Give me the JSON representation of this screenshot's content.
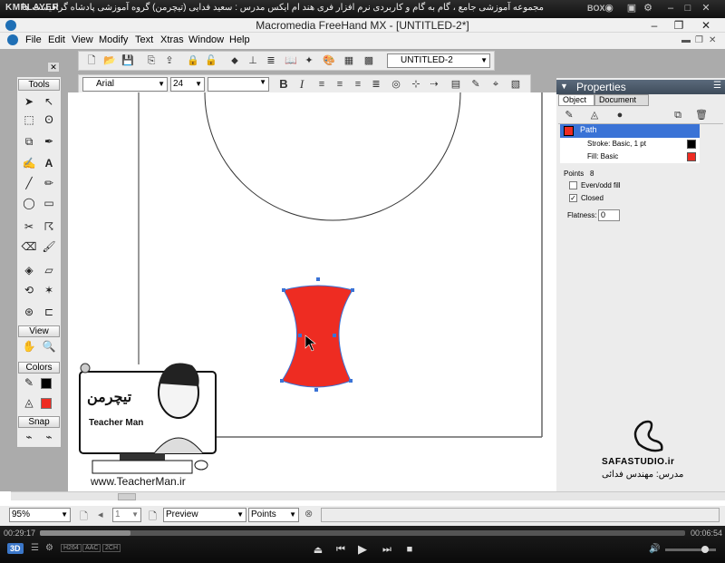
{
  "kmplayer": {
    "logo": "KMPLAYER",
    "title": "مجموعه آموزشی جامع ، گام به گام و کاربردی نرم افزار فری هند ام ایکس   مدرس : سعید فدایی (تیچرمن) گروه آموزشی پادشاه گرافیست ها",
    "box_label": "BOX",
    "time_current": "00:29:17",
    "time_total": "00:06:54",
    "badge_3d": "3D",
    "codec_labels": [
      "H264",
      "AAC",
      "2CH"
    ],
    "progress_fraction": 0.14
  },
  "app": {
    "title": "Macromedia FreeHand MX - [UNTITLED-2*]",
    "menu": [
      "File",
      "Edit",
      "View",
      "Modify",
      "Text",
      "Xtras",
      "Window",
      "Help"
    ],
    "document_name": "UNTITLED-2",
    "font_name": "Arial",
    "font_size": "24",
    "bold_label": "B",
    "italic_label": "I"
  },
  "tools": {
    "header": "Tools",
    "view_header": "View",
    "colors_header": "Colors",
    "snap_header": "Snap"
  },
  "properties": {
    "header": "Properties",
    "tabs": [
      "Object",
      "Document"
    ],
    "items": [
      {
        "label": "Path",
        "selected": true
      },
      {
        "label": "Stroke: Basic, 1 pt"
      },
      {
        "label": "Fill: Basic"
      }
    ],
    "points_label": "Points",
    "points_value": "8",
    "evenodd_label": "Even/odd fill",
    "closed_label": "Closed",
    "closed_checked": true,
    "flatness_label": "Flatness:",
    "flatness_value": "0"
  },
  "status": {
    "zoom": "95%",
    "page": "1",
    "mode": "Preview",
    "units": "Points"
  },
  "watermark": {
    "teacher_url": "www.TeacherMan.ir",
    "teacher_logo": "تیچرمن",
    "teacher_name": "Teacher Man",
    "studio": "SAFASTUDIO.ir",
    "instructor": "مدرس: مهندس فدائی"
  },
  "colors": {
    "fill": "#ee2c22",
    "selection": "#3a73d6",
    "stroke_swatch": "#000000"
  }
}
